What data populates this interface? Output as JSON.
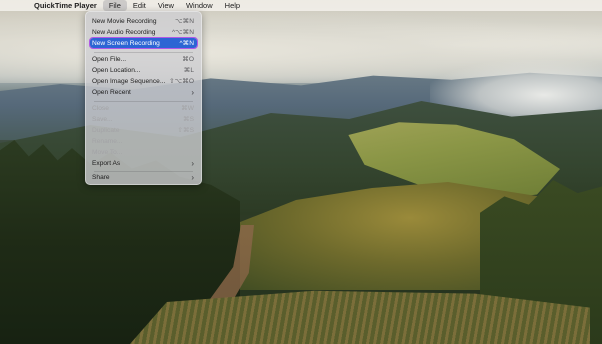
{
  "menubar": {
    "apple_icon": "",
    "app_name": "QuickTime Player",
    "items": [
      "File",
      "Edit",
      "View",
      "Window",
      "Help"
    ]
  },
  "file_menu": {
    "items": [
      {
        "label": "New Movie Recording",
        "shortcut": "⌥⌘N"
      },
      {
        "label": "New Audio Recording",
        "shortcut": "^⌥⌘N"
      },
      {
        "label": "New Screen Recording",
        "shortcut": "^⌘N"
      },
      {
        "label": "Open File...",
        "shortcut": "⌘O"
      },
      {
        "label": "Open Location...",
        "shortcut": "⌘L"
      },
      {
        "label": "Open Image Sequence...",
        "shortcut": "⇧⌥⌘O"
      },
      {
        "label": "Open Recent",
        "shortcut": ""
      },
      {
        "label": "Close",
        "shortcut": "⌘W"
      },
      {
        "label": "Save...",
        "shortcut": "⌘S"
      },
      {
        "label": "Duplicate",
        "shortcut": "⇧⌘S"
      },
      {
        "label": "Rename...",
        "shortcut": ""
      },
      {
        "label": "Move To...",
        "shortcut": ""
      },
      {
        "label": "Export As",
        "shortcut": ""
      },
      {
        "label": "Share",
        "shortcut": ""
      }
    ],
    "highlighted": "New Screen Recording"
  },
  "colors": {
    "highlight": "#2c65d4",
    "highlight_outline": "#b158e6",
    "disabled_text": "#a3a3a6"
  },
  "icons": {
    "apple": "apple-icon",
    "submenu": "chevron-right-icon"
  }
}
